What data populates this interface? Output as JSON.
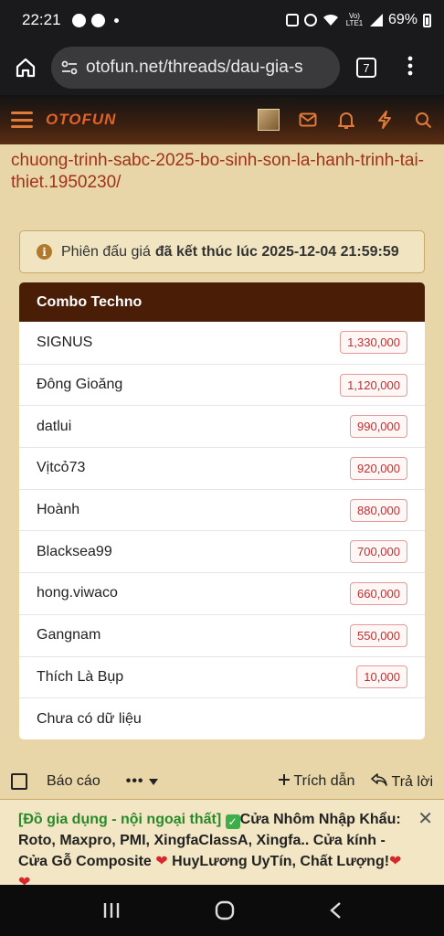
{
  "status_bar": {
    "time": "22:21",
    "battery": "69%",
    "lte_label": "Vo) LTE1"
  },
  "browser": {
    "url": "otofun.net/threads/dau-gia-s",
    "tab_count": "7"
  },
  "site": {
    "logo": "OTOFUN"
  },
  "content": {
    "link_lines": [
      "chuong-trinh-sabc-2025-bo-sinh-son-la-hanh-trinh-tai-",
      "thiet.1950230/"
    ],
    "notice_prefix": "Phiên đấu giá",
    "notice_bold": "đã kết thúc lúc 2025-12-04 21:59:59",
    "card_title": "Combo Techno",
    "bids": [
      {
        "name": "SIGNUS",
        "amount": "1,330,000"
      },
      {
        "name": "Đông Gioăng",
        "amount": "1,120,000"
      },
      {
        "name": "datlui",
        "amount": "990,000"
      },
      {
        "name": "Vịtcỏ73",
        "amount": "920,000"
      },
      {
        "name": "Hoành",
        "amount": "880,000"
      },
      {
        "name": "Blacksea99",
        "amount": "700,000"
      },
      {
        "name": "hong.viwaco",
        "amount": "660,000"
      },
      {
        "name": "Gangnam",
        "amount": "550,000"
      },
      {
        "name": "Thích Là Bụp",
        "amount": "10,000"
      },
      {
        "name": "Chưa có dữ liệu",
        "amount": ""
      }
    ]
  },
  "actions": {
    "report": "Báo cáo",
    "more": "•••",
    "quote": "Trích dẫn",
    "reply": "Trả lời"
  },
  "ad": {
    "tag": "[Đồ gia dụng - nội ngoại thất]",
    "text": "Cửa Nhôm Nhập Khẩu: Roto, Maxpro, PMI, XingfaClassA, Xingfa.. Cửa kính - Cửa Gỗ Composite",
    "tail_a": "HuyLương UyTín, Chất Lượng!",
    "close": "✕"
  }
}
